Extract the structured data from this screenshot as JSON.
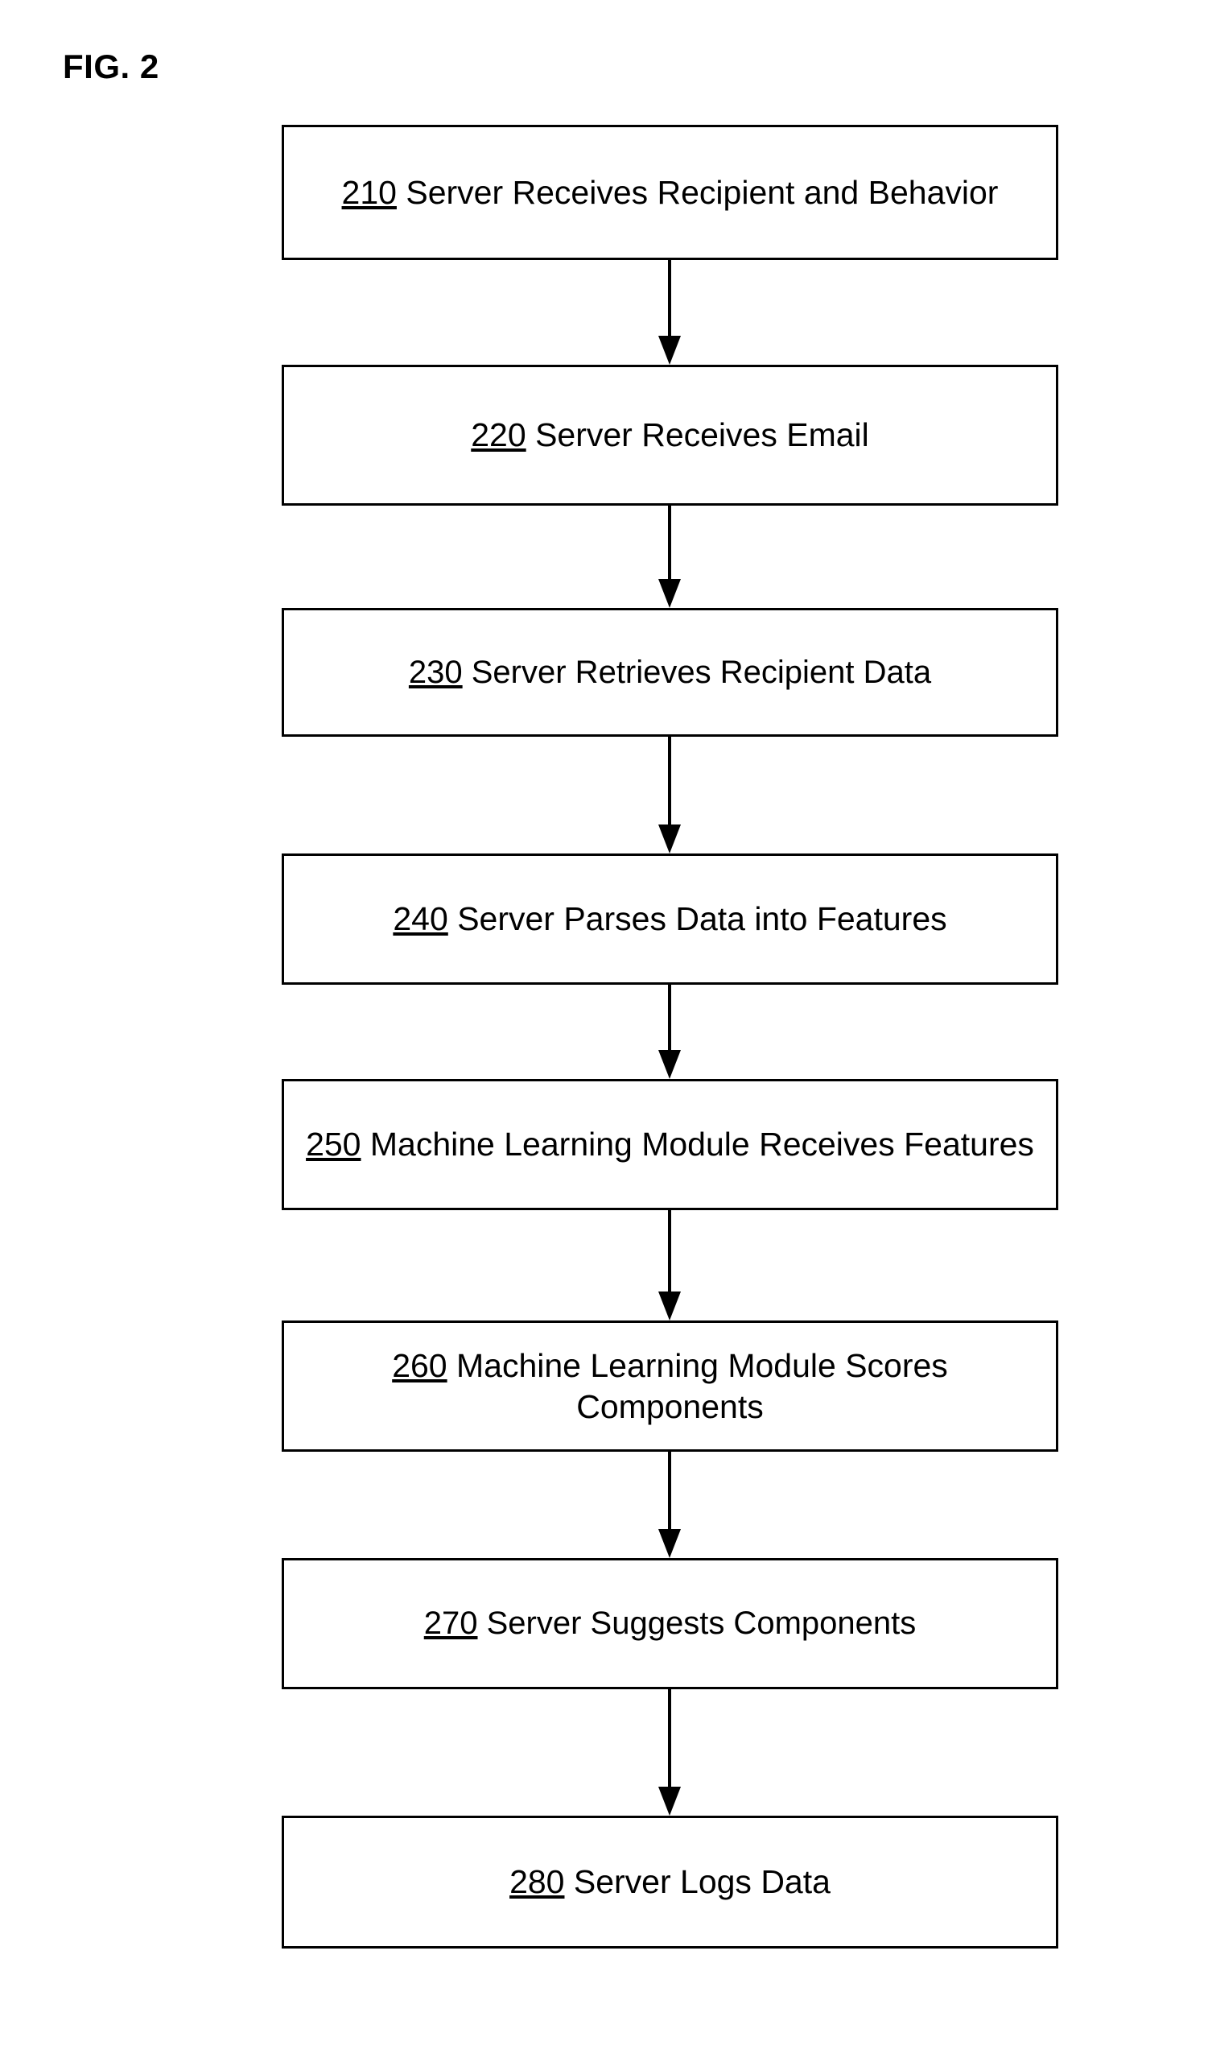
{
  "figure": {
    "label": "FIG. 2",
    "type": "process-flowchart",
    "orientation": "vertical-top-to-bottom",
    "colors": {
      "background": "#ffffff",
      "stroke": "#000000",
      "text": "#000000"
    }
  },
  "steps": [
    {
      "id": "210",
      "ref": "210",
      "text": " Server Receives Recipient and Behavior",
      "full_text": "210 Server Receives Recipient and Behavior",
      "lines": [
        "210 Server Receives Recipient and",
        "Behavior"
      ]
    },
    {
      "id": "220",
      "ref": "220",
      "text": " Server Receives Email",
      "full_text": "220 Server Receives Email",
      "lines": [
        "220 Server Receives Email"
      ]
    },
    {
      "id": "230",
      "ref": "230",
      "text": " Server Retrieves Recipient Data",
      "full_text": "230 Server Retrieves Recipient Data",
      "lines": [
        "230 Server Retrieves Recipient Data"
      ]
    },
    {
      "id": "240",
      "ref": "240",
      "text": " Server Parses Data into Features",
      "full_text": "240 Server Parses Data into Features",
      "lines": [
        "240 Server Parses Data into",
        "Features"
      ]
    },
    {
      "id": "250",
      "ref": "250",
      "text": " Machine Learning Module Receives Features",
      "full_text": "250 Machine Learning Module Receives Features",
      "lines": [
        "250 Machine Learning Module",
        "Receives Features"
      ]
    },
    {
      "id": "260",
      "ref": "260",
      "text": " Machine Learning Module Scores Components",
      "full_text": "260 Machine Learning Module Scores Components",
      "lines": [
        "260 Machine Learning Module",
        "Scores Components"
      ]
    },
    {
      "id": "270",
      "ref": "270",
      "text": " Server Suggests Components",
      "full_text": "270 Server Suggests Components",
      "lines": [
        "270 Server Suggests Components"
      ]
    },
    {
      "id": "280",
      "ref": "280",
      "text": " Server Logs Data",
      "full_text": "280 Server Logs Data",
      "lines": [
        "280 Server Logs Data"
      ]
    }
  ],
  "connectors": [
    {
      "from": "210",
      "to": "220"
    },
    {
      "from": "220",
      "to": "230"
    },
    {
      "from": "230",
      "to": "240"
    },
    {
      "from": "240",
      "to": "250"
    },
    {
      "from": "250",
      "to": "260"
    },
    {
      "from": "260",
      "to": "270"
    },
    {
      "from": "270",
      "to": "280"
    }
  ]
}
